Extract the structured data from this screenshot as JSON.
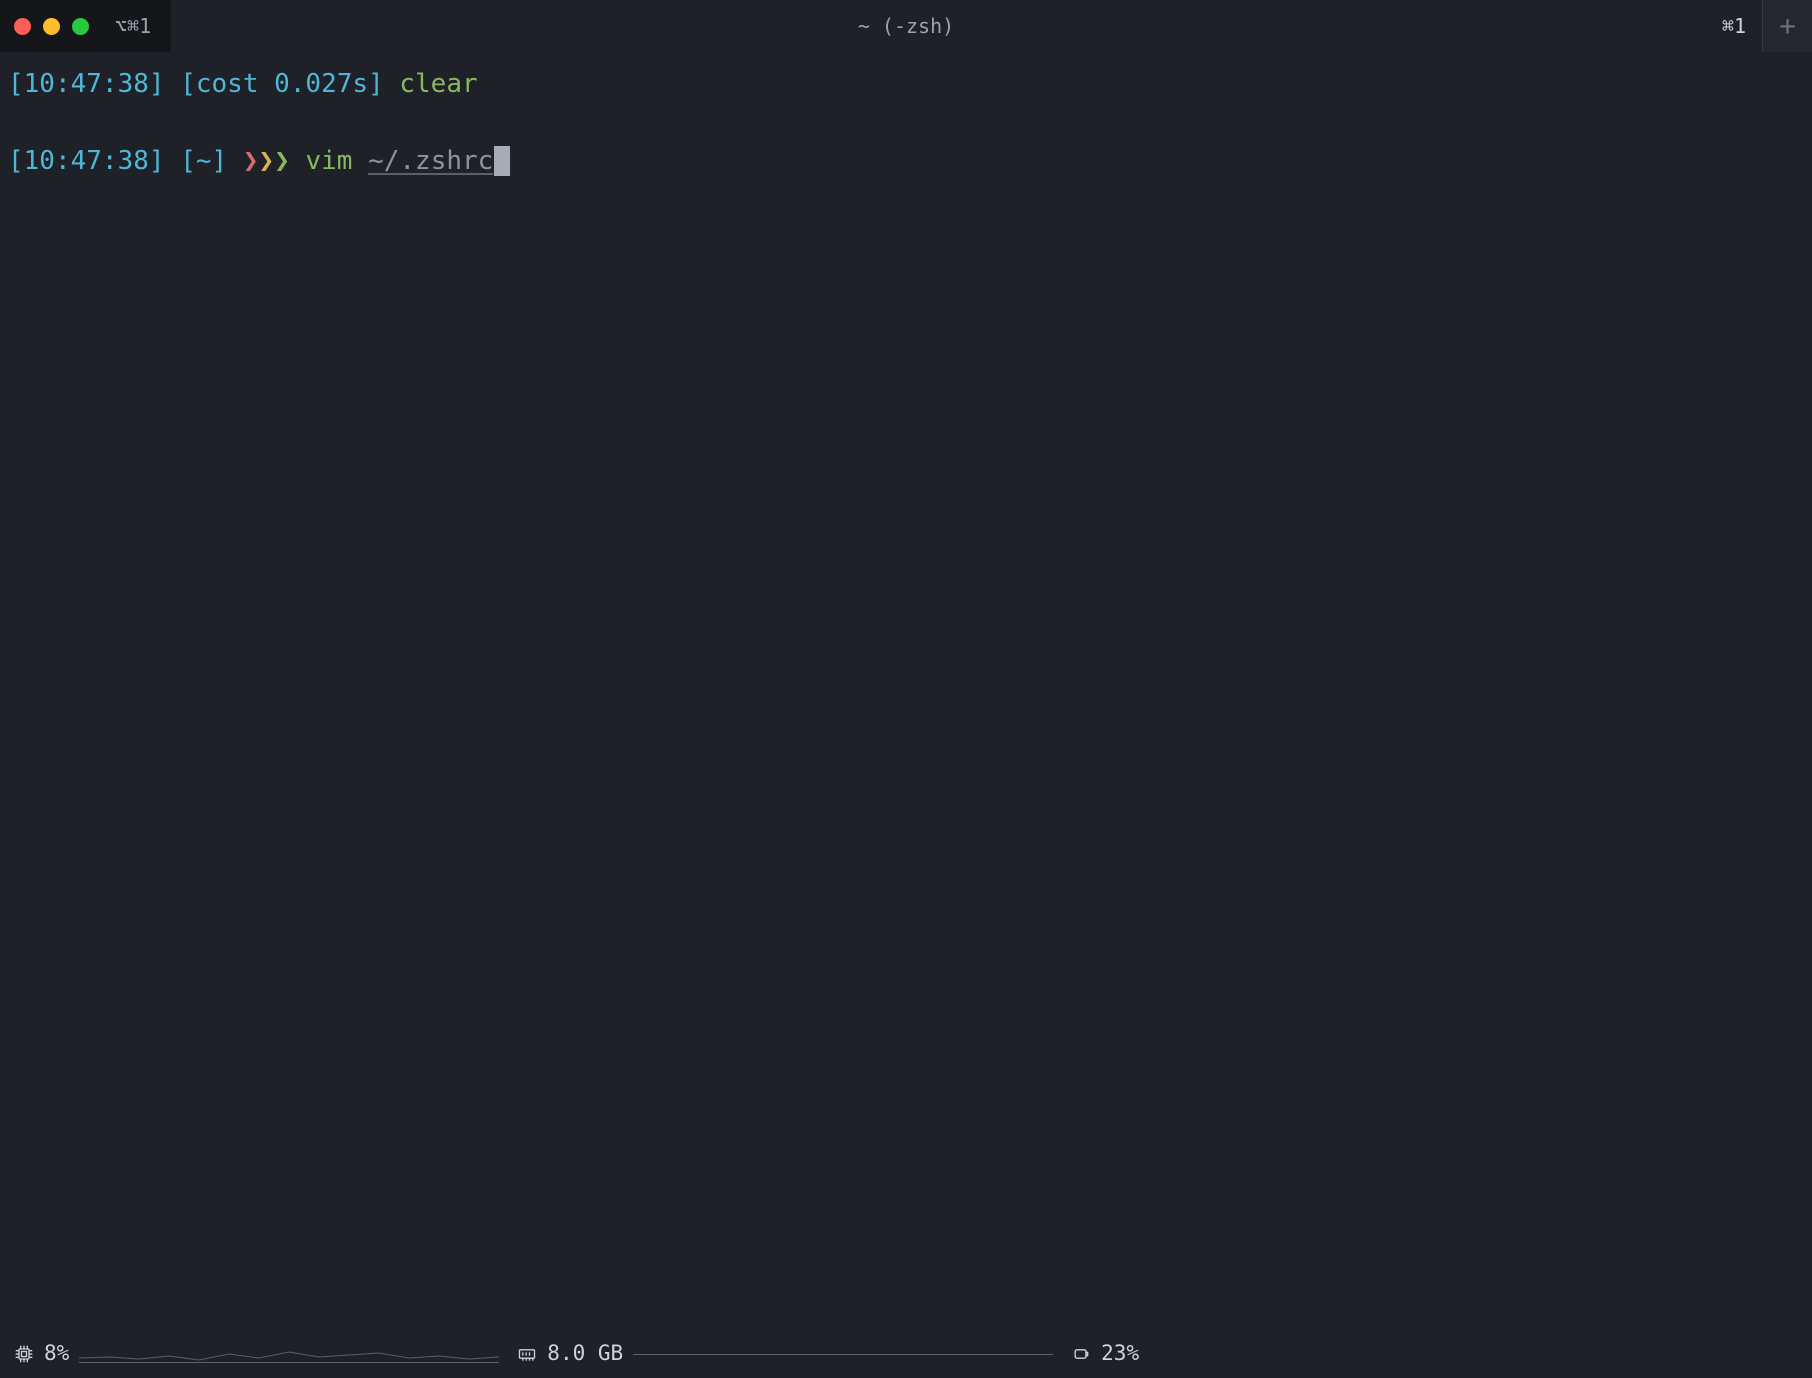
{
  "titlebar": {
    "tab_label": "⌥⌘1",
    "window_title": "~ (-zsh)",
    "shortcut_right": "⌘1",
    "new_tab": "+"
  },
  "terminal": {
    "line1": {
      "timestamp_open": "[",
      "timestamp": "10:47:38",
      "timestamp_close": "]",
      "cost_open": " [",
      "cost_label": "cost 0.027s",
      "cost_close": "]",
      "command": " clear"
    },
    "line2": {
      "timestamp_open": "[",
      "timestamp": "10:47:38",
      "timestamp_close": "]",
      "path_open": " [",
      "path": "~",
      "path_close": "]",
      "chevron1": " ❯",
      "chevron2": "❯",
      "chevron3": "❯",
      "command": " vim ",
      "arg": "~/.zshrc"
    }
  },
  "statusbar": {
    "cpu_pct": "8%",
    "mem": "8.0 GB",
    "battery_pct": "23%"
  }
}
